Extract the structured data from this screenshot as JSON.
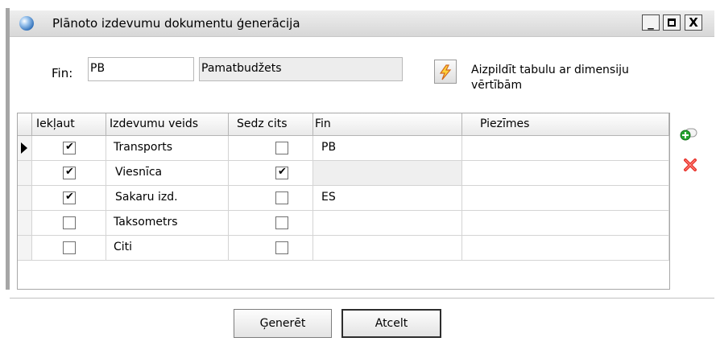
{
  "window": {
    "title": "Plānoto izdevumu dokumentu ģenerācija",
    "controls": {
      "minimize": "_",
      "close": "X"
    }
  },
  "form": {
    "fin_label": "Fin:",
    "fin_value": "PB",
    "fin_name": "Pamatbudžets",
    "fill_button_text": "Aizpildīt tabulu ar dimensiju vērtībām"
  },
  "grid": {
    "columns": [
      "Iekļaut",
      "Izdevumu veids",
      "Sedz cits",
      "Fin",
      "Piezīmes"
    ],
    "rows": [
      {
        "include": true,
        "type": "Transports",
        "covered": false,
        "fin": "PB",
        "notes": "",
        "current": true
      },
      {
        "include": true,
        "type": "Viesnīca",
        "covered": true,
        "fin": "",
        "notes": "",
        "current": false
      },
      {
        "include": true,
        "type": "Sakaru izd.",
        "covered": false,
        "fin": "ES",
        "notes": "",
        "current": false
      },
      {
        "include": false,
        "type": "Taksometrs",
        "covered": false,
        "fin": "",
        "notes": "",
        "current": false
      },
      {
        "include": false,
        "type": "Citi",
        "covered": false,
        "fin": "",
        "notes": "",
        "current": false
      }
    ]
  },
  "side_icons": [
    "add-row-icon",
    "delete-row-icon"
  ],
  "buttons": {
    "generate": "Ģenerēt",
    "cancel": "Atcelt"
  }
}
